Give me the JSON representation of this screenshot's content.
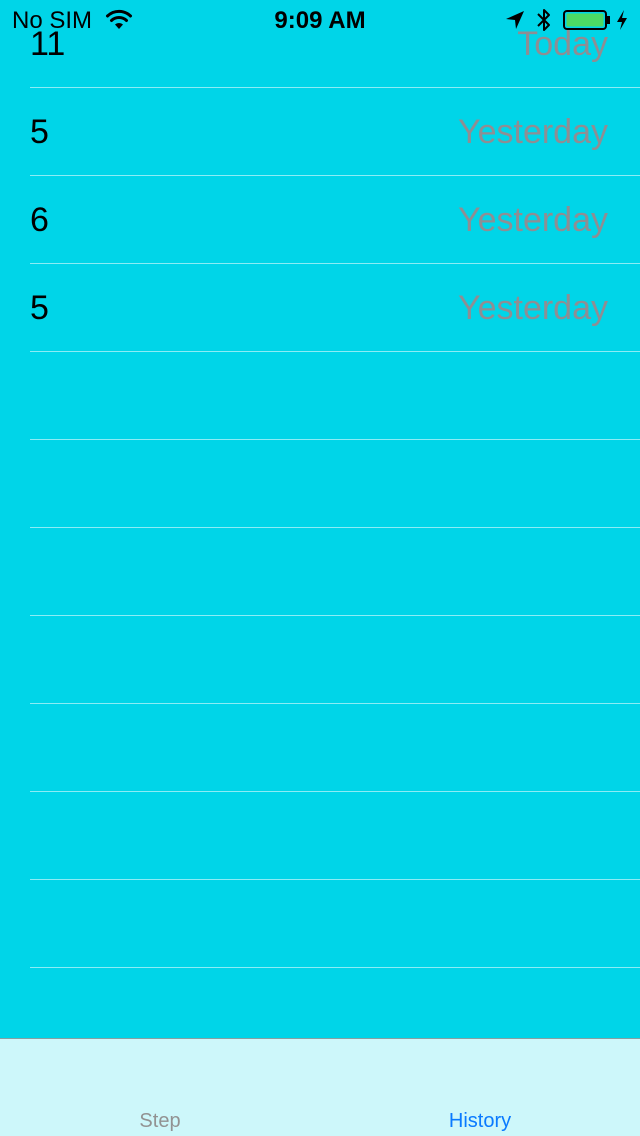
{
  "status_bar": {
    "carrier": "No SIM",
    "time": "9:09 AM"
  },
  "history": {
    "rows": [
      {
        "steps": "11",
        "day": "Today"
      },
      {
        "steps": "5",
        "day": "Yesterday"
      },
      {
        "steps": "6",
        "day": "Yesterday"
      },
      {
        "steps": "5",
        "day": "Yesterday"
      }
    ]
  },
  "tab_bar": {
    "tabs": [
      {
        "label": "Step",
        "selected": false
      },
      {
        "label": "History",
        "selected": true
      }
    ]
  },
  "colors": {
    "background": "#00d5e8",
    "tab_bar": "#cdf7fa",
    "tab_active": "#0a7aff",
    "tab_inactive": "#929292",
    "secondary_text": "#8e8e93",
    "battery_fill": "#4cd964"
  }
}
